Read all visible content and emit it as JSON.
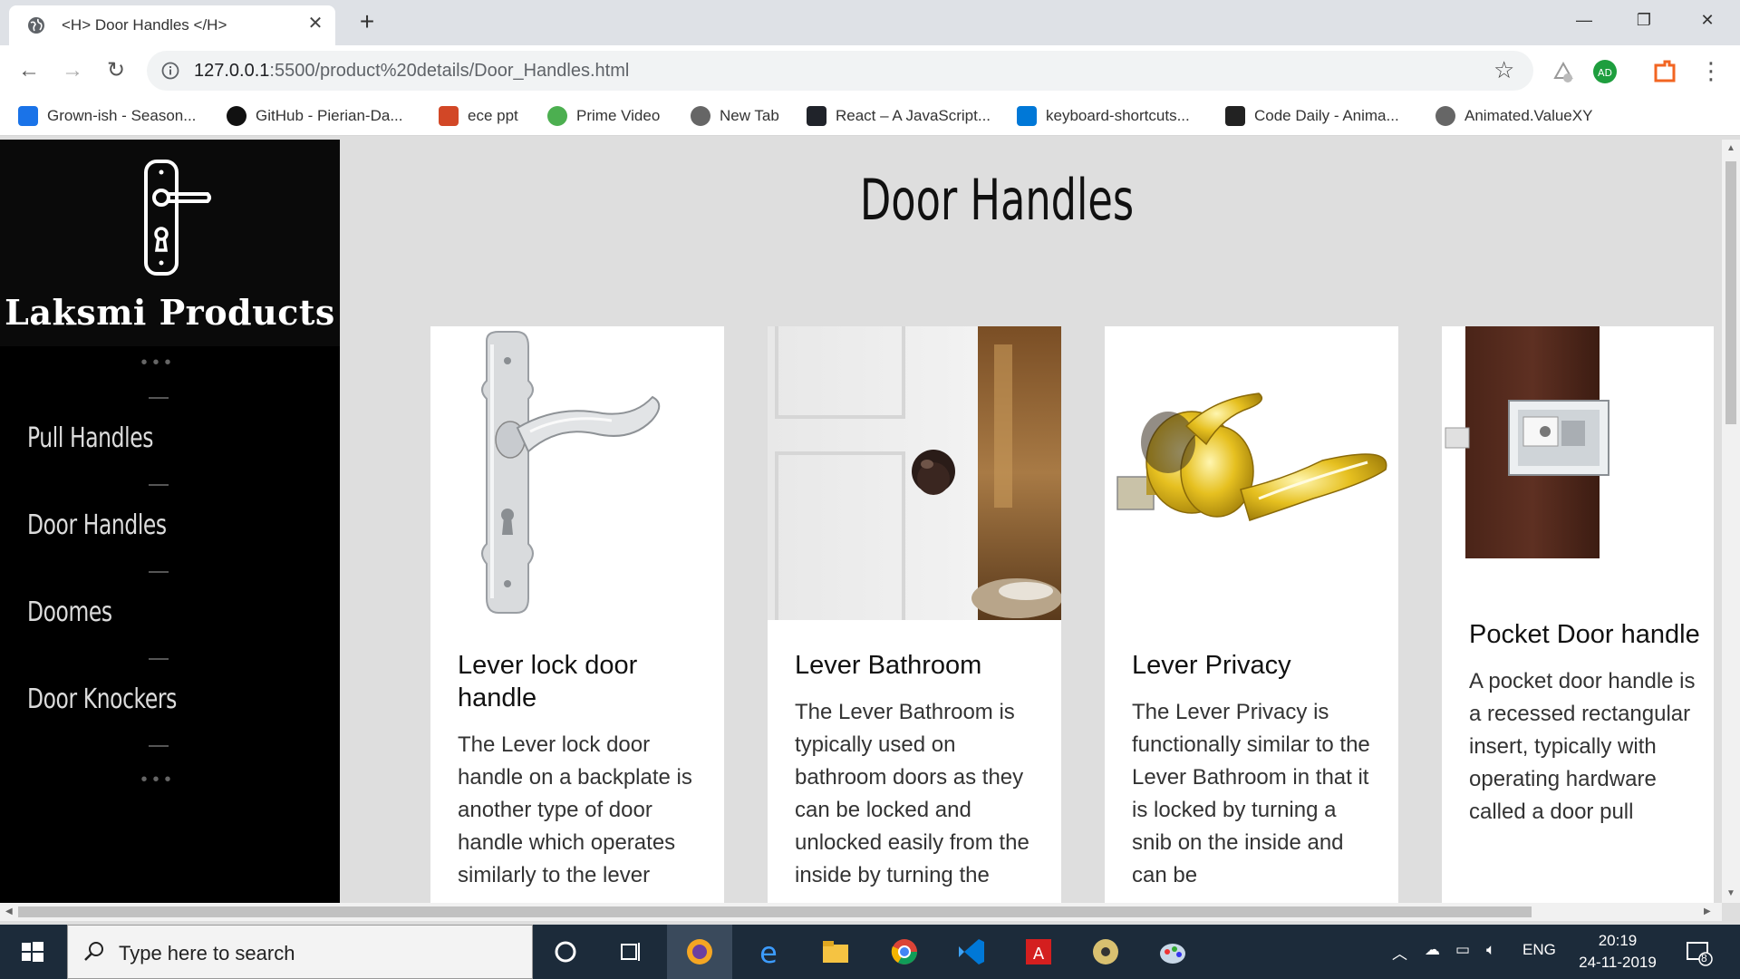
{
  "browser": {
    "tab_title": "<H> Door Handles </H>",
    "url_host": "127.0.0.1",
    "url_rest": ":5500/product%20details/Door_Handles.html",
    "bookmarks": [
      {
        "label": "Grown-ish - Season...",
        "icon": "play-icon",
        "color": "#1a73e8"
      },
      {
        "label": "GitHub - Pierian-Da...",
        "icon": "github-icon",
        "color": "#111111"
      },
      {
        "label": "ece ppt",
        "icon": "powerpoint-icon",
        "color": "#d24726"
      },
      {
        "label": "Prime Video",
        "icon": "prime-video-icon",
        "color": "#4caf50"
      },
      {
        "label": "New Tab",
        "icon": "globe-icon",
        "color": "#666666"
      },
      {
        "label": "React – A JavaScript...",
        "icon": "react-icon",
        "color": "#20232a"
      },
      {
        "label": "keyboard-shortcuts...",
        "icon": "vscode-icon",
        "color": "#0078d7"
      },
      {
        "label": "Code Daily - Anima...",
        "icon": "code-daily-icon",
        "color": "#222222"
      },
      {
        "label": "Animated.ValueXY",
        "icon": "globe-icon",
        "color": "#666666"
      }
    ]
  },
  "sidebar": {
    "brand": "Laksmi Products",
    "items": [
      {
        "label": "Pull Handles"
      },
      {
        "label": "Door Handles"
      },
      {
        "label": "Doomes"
      },
      {
        "label": "Door Knockers"
      }
    ]
  },
  "main": {
    "title": "Door Handles",
    "cards": [
      {
        "title": "Lever lock door handle",
        "text": "The Lever lock door handle on a backplate is another type of door handle which operates similarly to the lever",
        "image": "lever-lock-handle-image"
      },
      {
        "title": "Lever Bathroom",
        "text": "The Lever Bathroom is typically used on bathroom doors as they can be locked and unlocked easily from the inside by turning the",
        "image": "bathroom-door-knob-image"
      },
      {
        "title": "Lever Privacy",
        "text": "The Lever Privacy is functionally similar to the Lever Bathroom in that it is locked by turning a snib on the inside and can be",
        "image": "gold-lever-privacy-image"
      },
      {
        "title": "Pocket Door handle",
        "text": "A pocket door handle is a recessed rectangular insert, typically with operating hardware called a door pull",
        "image": "pocket-door-handle-image"
      }
    ]
  },
  "taskbar": {
    "search_placeholder": "Type here to search",
    "language": "ENG",
    "time": "20:19",
    "date": "24-11-2019",
    "notification_count": "8"
  },
  "colors": {
    "sidebar_bg": "#000000",
    "page_bg": "#dedede",
    "card_bg": "#ffffff"
  }
}
